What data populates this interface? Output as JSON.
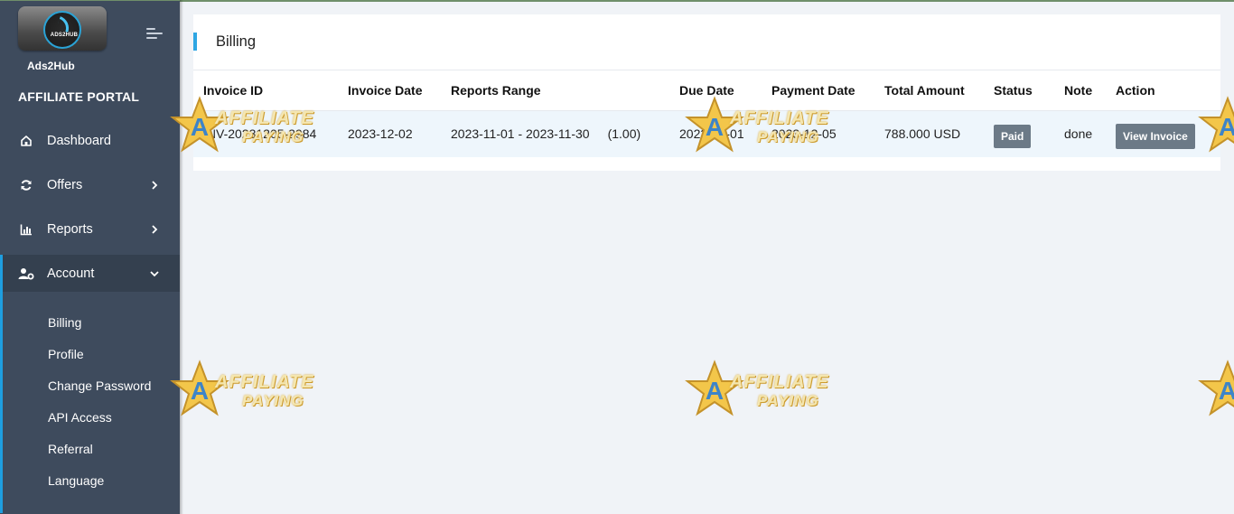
{
  "brand": {
    "logo_text": "ADS2HUB",
    "name": "Ads2Hub",
    "portal_title": "AFFILIATE PORTAL"
  },
  "nav": {
    "items": [
      {
        "label": "Dashboard",
        "icon": "home-icon"
      },
      {
        "label": "Offers",
        "icon": "refresh-icon"
      },
      {
        "label": "Reports",
        "icon": "bar-chart-icon"
      },
      {
        "label": "Account",
        "icon": "user-gear-icon"
      }
    ],
    "account_submenu": [
      "Billing",
      "Profile",
      "Change Password",
      "API Access",
      "Referral",
      "Language"
    ]
  },
  "page": {
    "title": "Billing"
  },
  "table": {
    "headers": [
      "Invoice ID",
      "Invoice Date",
      "Reports Range",
      "Due Date",
      "Payment Date",
      "Total Amount",
      "Status",
      "Note",
      "Action"
    ],
    "rows": [
      {
        "invoice_id": "INV-20231205-2984",
        "invoice_date": "2023-12-02",
        "reports_range": "2023-11-01 - 2023-11-30",
        "range_amount": "(1.00)",
        "due_date": "2023-12-01",
        "payment_date": "2023-12-05",
        "total_amount": "788.000 USD",
        "status": "Paid",
        "note": "done",
        "action": "View Invoice"
      }
    ]
  },
  "watermark": {
    "line1": "AFFILIATE",
    "line2": "PAYING"
  },
  "colors": {
    "sidebar": "#3e4b5d",
    "accent": "#1e9ee0",
    "badge": "#6c7a87",
    "row_highlight": "#eef6fc"
  }
}
